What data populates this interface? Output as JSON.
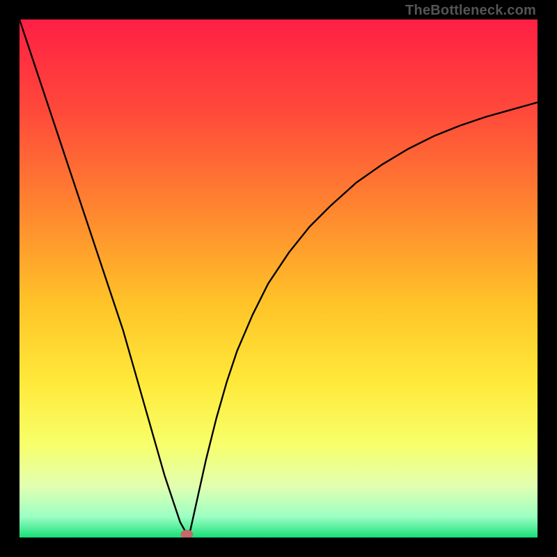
{
  "watermark": {
    "text": "TheBottleneck.com"
  },
  "chart_data": {
    "type": "line",
    "title": "",
    "xlabel": "",
    "ylabel": "",
    "xlim": [
      0,
      100
    ],
    "ylim": [
      0,
      100
    ],
    "grid": false,
    "legend": false,
    "background": {
      "type": "vertical-gradient",
      "stops": [
        {
          "offset": 0.0,
          "color": "#ff1f44"
        },
        {
          "offset": 0.18,
          "color": "#ff4a3a"
        },
        {
          "offset": 0.38,
          "color": "#ff8a2f"
        },
        {
          "offset": 0.55,
          "color": "#ffc428"
        },
        {
          "offset": 0.7,
          "color": "#ffe93a"
        },
        {
          "offset": 0.82,
          "color": "#f7ff6a"
        },
        {
          "offset": 0.9,
          "color": "#e2ffb0"
        },
        {
          "offset": 0.96,
          "color": "#9cffc4"
        },
        {
          "offset": 1.0,
          "color": "#18e07a"
        }
      ]
    },
    "series": [
      {
        "name": "bottleneck-curve",
        "color": "#000000",
        "stroke_width": 2.4,
        "x": [
          0,
          2,
          4,
          6,
          8,
          10,
          12,
          14,
          16,
          18,
          20,
          22,
          24,
          26,
          28,
          30,
          31,
          32,
          32.5,
          33,
          34,
          36,
          38,
          40,
          42,
          45,
          48,
          52,
          56,
          60,
          65,
          70,
          75,
          80,
          85,
          90,
          95,
          100
        ],
        "y": [
          100,
          94,
          88,
          82,
          76,
          70,
          64,
          58,
          52,
          46,
          40,
          33,
          26,
          19,
          12,
          6,
          3,
          1.2,
          0.4,
          1.5,
          6,
          15,
          23,
          30,
          36,
          43,
          49,
          55,
          60,
          64,
          68.5,
          72,
          75,
          77.5,
          79.5,
          81.2,
          82.6,
          84
        ]
      }
    ],
    "marker": {
      "name": "optimal-point",
      "x": 32.3,
      "y": 0.6,
      "rx": 1.2,
      "ry": 0.9,
      "color": "#c46a6a"
    }
  }
}
